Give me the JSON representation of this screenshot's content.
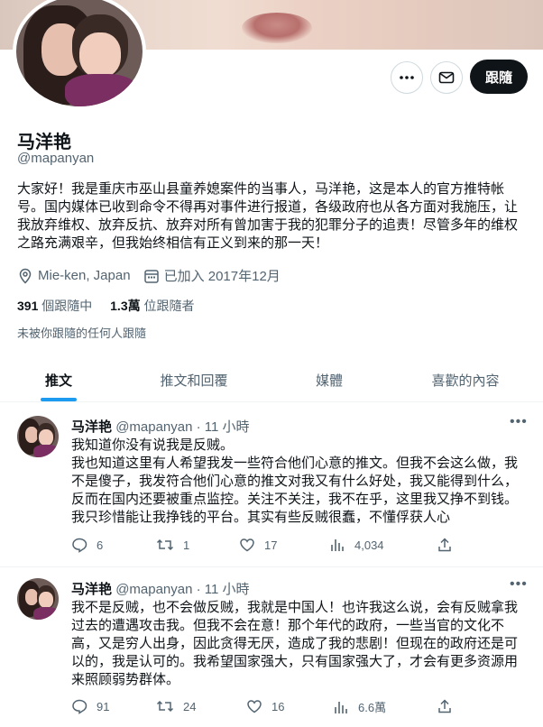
{
  "profile": {
    "name": "马洋艳",
    "handle": "@mapanyan",
    "follow_label": "跟隨",
    "bio": "大家好！我是重庆市巫山县童养媳案件的当事人，马洋艳，这是本人的官方推特帐号。国内媒体已收到命令不得再对事件进行报道，各级政府也从各方面对我施压，让我放弃维权、放弃反抗、放弃对所有曾加害于我的犯罪分子的追责！尽管多年的维权之路充满艰辛，但我始终相信有正义到来的那一天！",
    "location": "Mie-ken, Japan",
    "joined": "已加入 2017年12月",
    "following_count": "391",
    "following_label": "個跟隨中",
    "followers_count": "1.3萬",
    "followers_label": "位跟隨者",
    "not_followed_text": "未被你跟隨的任何人跟隨"
  },
  "icons": {
    "more": "more-icon",
    "message": "mail-icon",
    "location": "location-pin-icon",
    "calendar": "calendar-icon",
    "reply": "reply-icon",
    "retweet": "retweet-icon",
    "like": "heart-icon",
    "views": "views-chart-icon",
    "share": "share-icon"
  },
  "tabs": [
    {
      "label": "推文",
      "active": true
    },
    {
      "label": "推文和回覆",
      "active": false
    },
    {
      "label": "媒體",
      "active": false
    },
    {
      "label": "喜歡的內容",
      "active": false
    }
  ],
  "tweets": [
    {
      "name": "马洋艳",
      "handle": "@mapanyan",
      "time": "· 11 小時",
      "text_lines": [
        "我知道你没有说我是反贼。",
        "我也知道这里有人希望我发一些符合他们心意的推文。但我不会这么做，我",
        "不是傻子，我发符合他们心意的推文对我又有什么好处，我又能得到什么，",
        "反而在国内还要被重点监控。关注不关注，我不在乎，这里我又挣不到钱。",
        "我只珍惜能让我挣钱的平台。其实有些反贼很蠢，不懂俘获人心"
      ],
      "replies": "6",
      "retweets": "1",
      "likes": "17",
      "views": "4,034"
    },
    {
      "name": "马洋艳",
      "handle": "@mapanyan",
      "time": "· 11 小時",
      "text_lines": [
        "我不是反贼，也不会做反贼，我就是中国人！也许我这么说，会有反贼拿我",
        "过去的遭遇攻击我。但我不会在意！那个年代的政府，一些当官的文化不",
        "高，又是穷人出身，因此贪得无厌，造成了我的悲剧！但现在的政府还是可",
        "以的，我是认可的。我希望国家强大，只有国家强大了，才会有更多资源用",
        "来照顾弱势群体。"
      ],
      "replies": "91",
      "retweets": "24",
      "likes": "16",
      "views": "6.6萬"
    }
  ]
}
